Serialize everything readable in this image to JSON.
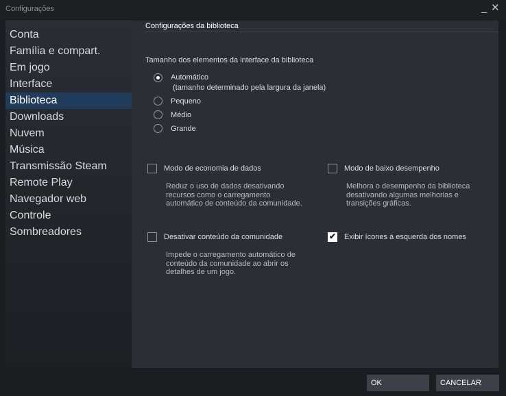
{
  "window": {
    "title": "Configurações",
    "minimize_glyph": "_",
    "close_glyph": "✕"
  },
  "sidebar": {
    "items": [
      {
        "label": "Conta",
        "active": false
      },
      {
        "label": "Família e compart.",
        "active": false
      },
      {
        "label": "Em jogo",
        "active": false
      },
      {
        "label": "Interface",
        "active": false
      },
      {
        "label": "Biblioteca",
        "active": true
      },
      {
        "label": "Downloads",
        "active": false
      },
      {
        "label": "Nuvem",
        "active": false
      },
      {
        "label": "Música",
        "active": false
      },
      {
        "label": "Transmissão Steam",
        "active": false
      },
      {
        "label": "Remote Play",
        "active": false
      },
      {
        "label": "Navegador web",
        "active": false
      },
      {
        "label": "Controle",
        "active": false
      },
      {
        "label": "Sombreadores",
        "active": false
      }
    ]
  },
  "content": {
    "section_title": "Configurações da biblioteca",
    "size_group": {
      "label": "Tamanho dos elementos da interface da biblioteca",
      "options": [
        {
          "label": "Automático",
          "sub": "(tamanho determinado pela largura da janela)",
          "selected": true
        },
        {
          "label": "Pequeno",
          "selected": false
        },
        {
          "label": "Médio",
          "selected": false
        },
        {
          "label": "Grande",
          "selected": false
        }
      ]
    },
    "checkboxes": [
      {
        "label": "Modo de economia de dados",
        "checked": false,
        "desc": [
          "Reduz o uso de dados desativando",
          "recursos como o carregamento",
          "automático de conteúdo da comunidade."
        ]
      },
      {
        "label": "Modo de baixo desempenho",
        "checked": false,
        "desc": [
          "Melhora o desempenho da biblioteca",
          "desativando algumas melhorias e",
          "transições gráficas."
        ]
      },
      {
        "label": "Desativar conteúdo da comunidade",
        "checked": false,
        "desc": [
          "Impede o carregamento automático de",
          "conteúdo da comunidade ao abrir os",
          "detalhes de um jogo."
        ]
      },
      {
        "label": "Exibir ícones à esquerda dos nomes",
        "checked": true,
        "desc": []
      }
    ]
  },
  "footer": {
    "ok_label": "OK",
    "cancel_label": "CANCELAR"
  },
  "colors": {
    "active_nav": "#213c5b",
    "panel_bg": "#2b2e35",
    "button_bg": "#3d4048"
  }
}
